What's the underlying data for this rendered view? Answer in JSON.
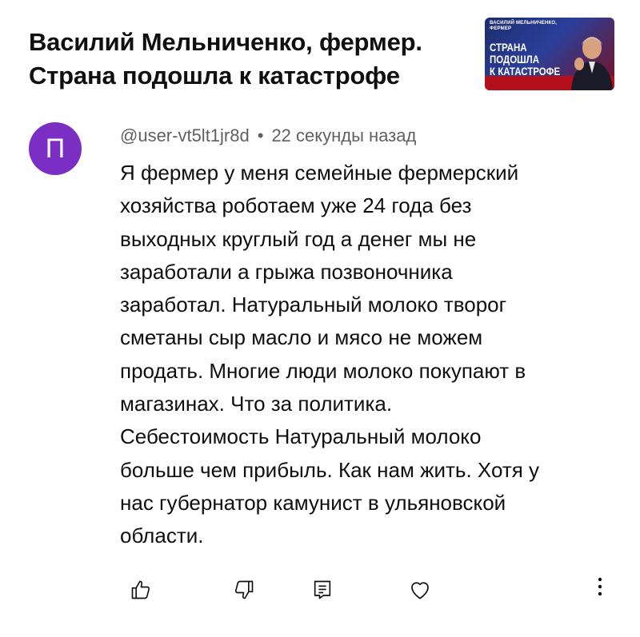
{
  "video": {
    "title": "Василий Мельниченко, фермер.\nСтрана подошла к катастрофе",
    "thumbnail": {
      "top_text": "ВАСИЛИЙ МЕЛЬНИЧЕНКО,\nФЕРМЕР",
      "headline": "СТРАНА\nПОДОШЛА\nК КАТАСТРОФЕ"
    }
  },
  "comment": {
    "avatar_letter": "П",
    "avatar_color": "#7a2ec4",
    "author": "@user-vt5lt1jr8d",
    "separator": "•",
    "time": "22 секунды назад",
    "text": "Я фермер у меня семейные фермерский\nхозяйства роботаем уже 24 года без\nвыходных круглый год а денег мы не\nзаработали а грыжа позвоночника\nзаработал. Натуральный молоко творог\nсметаны сыр масло и мясо не можем\nпродать. Многие люди молоко покупают в\nмагазинах. Что за политика.\nСебестоимость Натуральный молоко\nбольше чем прибыль. Как нам жить. Хотя у\nнас губернатор камунист в ульяновской\nобласти."
  },
  "actions": {
    "like_icon": "thumbs-up-icon",
    "dislike_icon": "thumbs-down-icon",
    "reply_icon": "reply-icon",
    "heart_icon": "heart-icon",
    "more_icon": "more-vertical-icon"
  }
}
